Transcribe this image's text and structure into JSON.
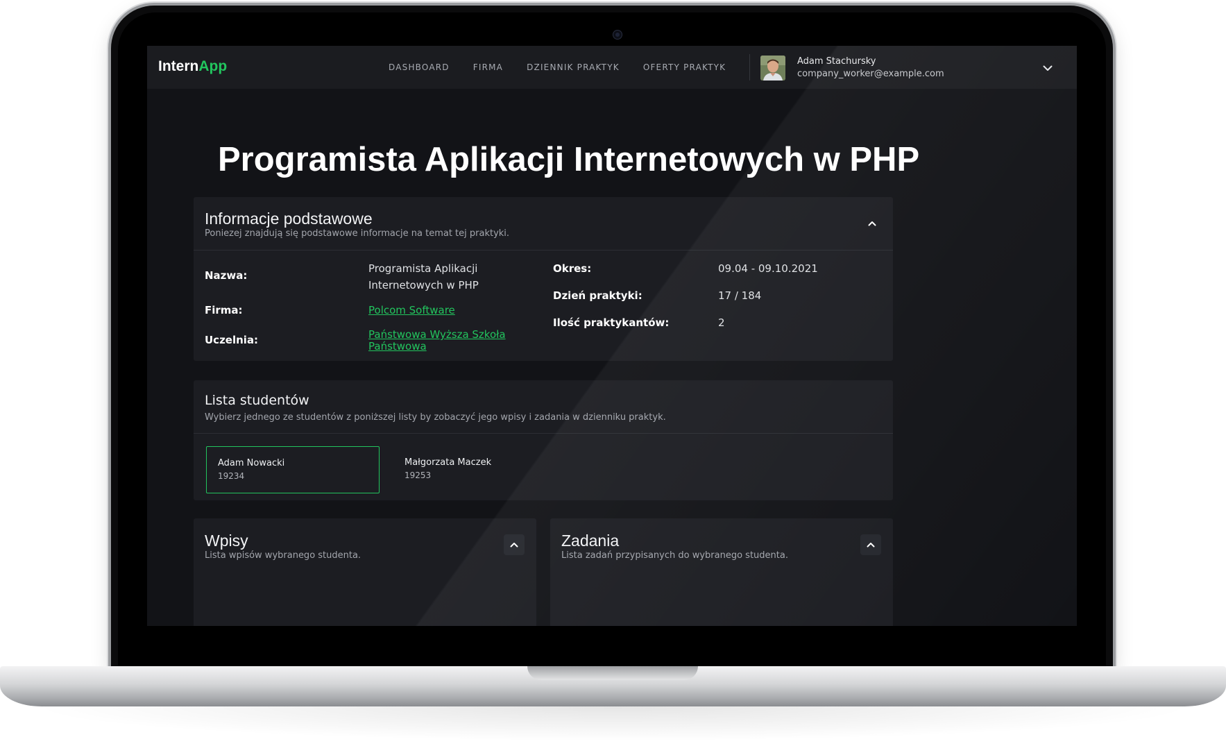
{
  "nav": {
    "brand_main": "Intern",
    "brand_accent": "App",
    "links": [
      "DASHBOARD",
      "FIRMA",
      "DZIENNIK PRAKTYK",
      "OFERTY PRAKTYK"
    ],
    "user_name": "Adam Stachursky",
    "user_email": "company_worker@example.com"
  },
  "page": {
    "title": "Programista Aplikacji Internetowych w PHP"
  },
  "info": {
    "title": "Informacje podstawowe",
    "subtitle": "Poniezej znajdują się podstawowe informacje na temat tej praktyki.",
    "fields": {
      "name_label": "Nazwa:",
      "name_value": "Programista Aplikacji Internetowych w PHP",
      "company_label": "Firma:",
      "company_value": "Polcom Software",
      "school_label": "Uczelnia:",
      "school_value": "Państwowa Wyższa Szkoła Państwowa",
      "period_label": "Okres:",
      "period_value": "09.04 - 09.10.2021",
      "day_label": "Dzień praktyki:",
      "day_value": "17 / 184",
      "count_label": "Ilość praktykantów:",
      "count_value": "2"
    }
  },
  "students": {
    "title": "Lista studentów",
    "subtitle": "Wybierz jednego ze studentów z poniższej listy by zobaczyć jego wpisy i zadania w dzienniku praktyk.",
    "items": [
      {
        "name": "Adam Nowacki",
        "id": "19234",
        "selected": true
      },
      {
        "name": "Małgorzata Maczek",
        "id": "19253",
        "selected": false
      }
    ]
  },
  "entries": {
    "title": "Wpisy",
    "subtitle": "Lista wpisów wybranego studenta."
  },
  "tasks": {
    "title": "Zadania",
    "subtitle": "Lista zadań przypisanych do wybranego studenta."
  },
  "colors": {
    "accent": "#22c55e",
    "background": "#121317",
    "card": "#1c1d22"
  }
}
